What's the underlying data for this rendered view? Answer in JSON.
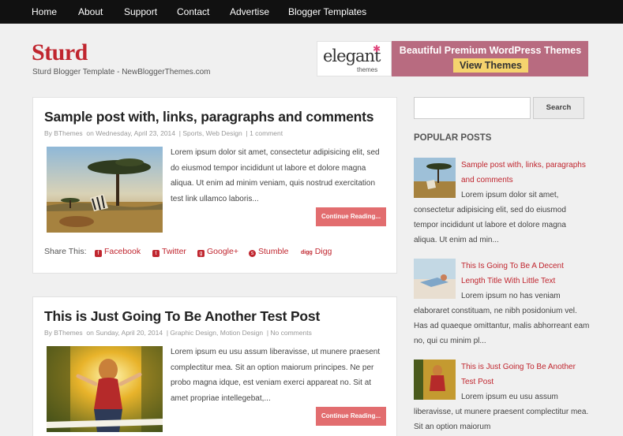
{
  "nav": [
    "Home",
    "About",
    "Support",
    "Contact",
    "Advertise",
    "Blogger Templates"
  ],
  "site": {
    "name": "Sturd",
    "tagline": "Sturd Blogger Template - NewBloggerThemes.com"
  },
  "ad": {
    "logo_main": "elegant",
    "logo_sub": "themes",
    "title": "Beautiful Premium WordPress Themes",
    "button": "View Themes"
  },
  "posts": [
    {
      "title": "Sample post with, links, paragraphs and comments",
      "meta_by": "By BThemes",
      "meta_on": "on Wednesday, April 23, 2014",
      "meta_labels": "| Sports, Web Design",
      "meta_comments": "| 1 comment",
      "excerpt": "Lorem ipsum dolor sit amet, consectetur adipisicing elit, sed do eiusmod tempor incididunt ut labore et dolore magna aliqua. Ut enim ad minim veniam, quis nostrud exercitation test link ullamco laboris...",
      "read_more": "Continue Reading..."
    },
    {
      "title": "This is Just Going To Be Another Test Post",
      "meta_by": "By BThemes",
      "meta_on": "on Sunday, April 20, 2014",
      "meta_labels": "| Graphic Design, Motion Design",
      "meta_comments": "| No comments",
      "excerpt": "Lorem ipsum eu usu assum liberavisse, ut munere praesent complectitur mea. Sit an option maiorum principes. Ne per probo magna idque, est veniam exerci appareat no. Sit at amet propriae intellegebat,...",
      "read_more": "Continue Reading..."
    }
  ],
  "share": {
    "label": "Share This:",
    "items": [
      "Facebook",
      "Twitter",
      "Google+",
      "Stumble",
      "Digg"
    ],
    "icons": [
      "facebook-icon",
      "twitter-icon",
      "google-plus-icon",
      "stumbleupon-icon",
      "digg-icon"
    ],
    "icon_glyphs": [
      "f",
      "t",
      "g",
      "s",
      "digg"
    ]
  },
  "sidebar": {
    "search_button": "Search",
    "popular_heading": "POPULAR POSTS",
    "popular": [
      {
        "title": "Sample post with, links, paragraphs and comments",
        "excerpt": "Lorem ipsum dolor sit amet, consectetur adipisicing elit, sed do eiusmod tempor incididunt ut labore et dolore magna aliqua. Ut enim ad min..."
      },
      {
        "title": "This Is Going To Be A Decent Length Title With Little Text",
        "excerpt": "Lorem ipsum no has veniam elaboraret constituam, ne nibh posidonium vel. Has ad quaeque omittantur, malis abhorreant eam no, qui cu minim pl..."
      },
      {
        "title": "This is Just Going To Be Another Test Post",
        "excerpt": "Lorem ipsum eu usu assum liberavisse, ut munere praesent complectitur mea. Sit an option maiorum"
      }
    ]
  },
  "colors": {
    "accent": "#c0262f",
    "nav_bg": "#111111",
    "read_more_bg": "#e26d6f",
    "ad_bg": "#b86b80",
    "ad_button": "#f5d36e"
  }
}
